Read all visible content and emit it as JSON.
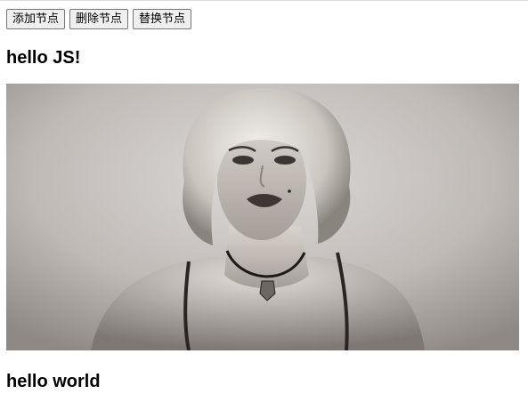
{
  "toolbar": {
    "add_label": "添加节点",
    "remove_label": "删除节点",
    "replace_label": "替换节点"
  },
  "headings": {
    "first": "hello JS!",
    "second": "hello world"
  },
  "photo": {
    "subject": "black-and-white portrait photo of a woman with curly blonde hair wearing a choker pendant necklace"
  },
  "colors": {
    "page_background": "#ffffff",
    "button_background": "#efefef",
    "button_border": "#767676"
  }
}
